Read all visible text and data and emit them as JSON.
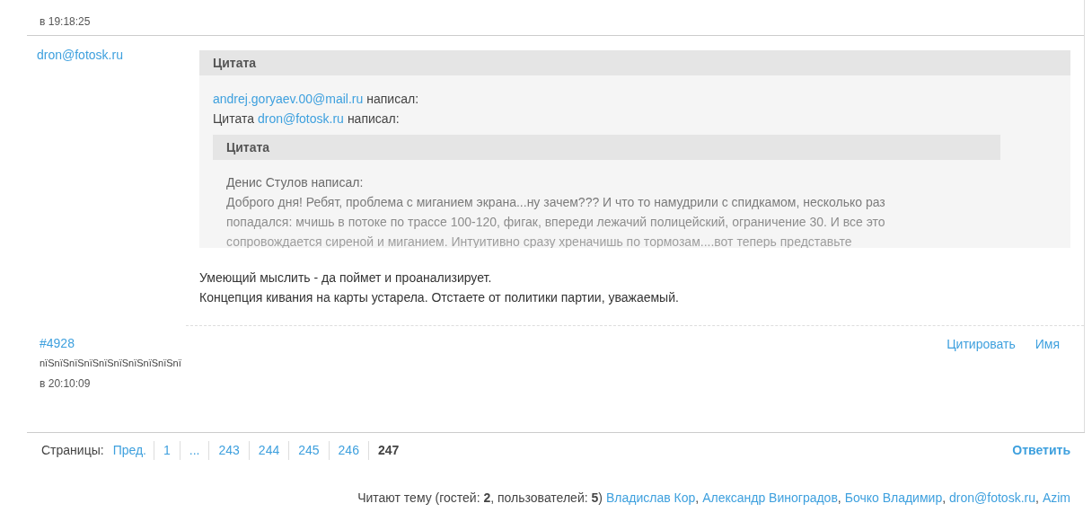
{
  "previous_post": {
    "time": "в 19:18:25"
  },
  "post": {
    "author": "dron@fotosk.ru",
    "quote": {
      "title": "Цитата",
      "lines": [
        [
          {
            "kind": "link",
            "text": "andrej.goryaev.00@mail.ru"
          },
          {
            "kind": "text",
            "text": "написал:"
          }
        ],
        [
          {
            "kind": "text",
            "text": "Цитата"
          },
          {
            "kind": "link",
            "text": "dron@fotosk.ru"
          },
          {
            "kind": "text",
            "text": "написал:"
          }
        ]
      ],
      "inner_quote": {
        "title": "Цитата",
        "author_line": "Денис Стулов написал:",
        "text": "Доброго дня! Ребят, проблема с миганием экрана...ну зачем??? И что то намудрили с спидкамом, несколько раз попадался: мчишь в потоке по трассе 100-120, фигак, впереди лежачий полицейский, ограничение 30. И все это сопровождается сиреной и миганием. Интуитивно сразу хреначишь по тормозам....вот теперь представьте"
      }
    },
    "body": [
      "Умеющий мыслить - да поймет и проанализирует.",
      "Концепция кивания на карты устарела. Отстаете от политики партии, уважаемый."
    ],
    "number": "#4928",
    "status": "nïSnïSnïSnïSnïSnïSnïSnïSnïSnï",
    "time": "в 20:10:09",
    "actions": [
      "Цитировать",
      "Имя"
    ]
  },
  "pagination": {
    "label": "Страницы:",
    "pages": [
      {
        "text": "Пред.",
        "selected": false
      },
      {
        "text": "1",
        "selected": false
      },
      {
        "text": "...",
        "selected": false
      },
      {
        "text": "243",
        "selected": false
      },
      {
        "text": "244",
        "selected": false
      },
      {
        "text": "245",
        "selected": false
      },
      {
        "text": "246",
        "selected": false
      },
      {
        "text": "247",
        "selected": true
      }
    ],
    "reply": "Ответить"
  },
  "readers": {
    "summary": "Читают тему (гостей: **2**, пользователей: **5**)",
    "separator": ",",
    "users": [
      "Владислав Кор",
      "Александр Виноградов",
      "Бочко Владимир",
      "dron@fotosk.ru",
      "Azim"
    ]
  }
}
